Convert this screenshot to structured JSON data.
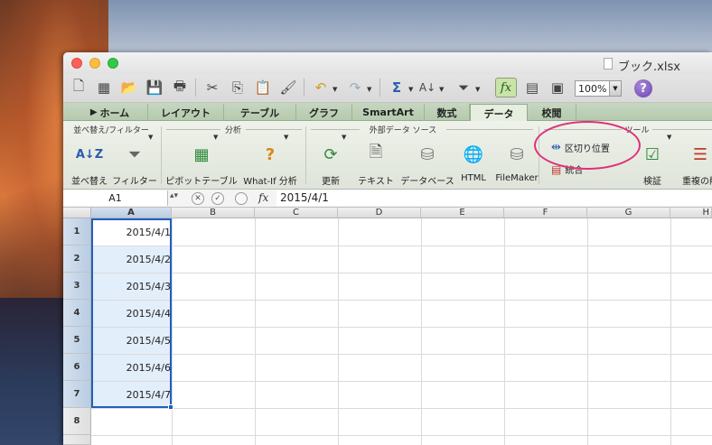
{
  "window": {
    "title": "ブック.xlsx"
  },
  "toolbar": {
    "zoom": "100%",
    "fx_label": "fx",
    "help": "?"
  },
  "tabs": [
    "ホーム",
    "レイアウト",
    "テーブル",
    "グラフ",
    "SmartArt",
    "数式",
    "データ",
    "校閲"
  ],
  "active_tab": "データ",
  "ribbon": {
    "groups": {
      "sort_filter": "並べ替え/フィルター",
      "analysis": "分析",
      "external": "外部データ ソース",
      "tools": "ツール"
    },
    "items": {
      "sort": "並べ替え",
      "filter": "フィルター",
      "pivot": "ピボットテーブル",
      "whatif": "What-If 分析",
      "refresh": "更新",
      "text": "テキスト",
      "database": "データベース",
      "html": "HTML",
      "filemaker": "FileMaker",
      "text_to_columns": "区切り位置",
      "consolidate": "統合",
      "validate": "検証",
      "duplicates": "重複の削"
    }
  },
  "formula_bar": {
    "name_box": "A1",
    "fx": "fx",
    "value": "2015/4/1"
  },
  "sheet": {
    "columns": [
      "A",
      "B",
      "C",
      "D",
      "E",
      "F",
      "G",
      "H"
    ],
    "rows": [
      "1",
      "2",
      "3",
      "4",
      "5",
      "6",
      "7",
      "8"
    ],
    "cells_a": [
      "2015/4/1",
      "2015/4/2",
      "2015/4/3",
      "2015/4/4",
      "2015/4/5",
      "2015/4/6",
      "2015/4/7"
    ]
  },
  "colors": {
    "accent": "#1f5fbf",
    "highlight_ellipse": "#e0307a",
    "tab_bar": "#b5caae"
  }
}
